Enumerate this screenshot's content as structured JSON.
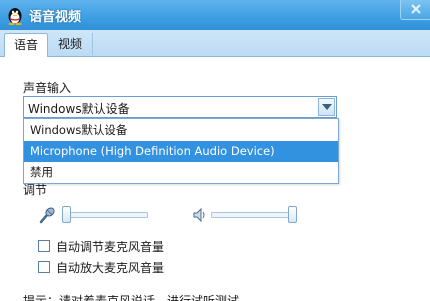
{
  "window": {
    "title": "语音视频"
  },
  "tabs": [
    {
      "label": "语音",
      "active": true
    },
    {
      "label": "视频",
      "active": false
    }
  ],
  "voice": {
    "input_label": "声音输入",
    "input_device": {
      "selected": "Windows默认设备"
    },
    "dropdown_options": [
      "Windows默认设备",
      "Microphone (High Definition Audio Device)",
      "禁用"
    ],
    "highlighted_option": "Microphone (High Definition Audio Device)",
    "adjust_label": "调节",
    "auto_adjust_mic": {
      "label": "自动调节麦克风音量",
      "checked": false
    },
    "auto_amplify_mic": {
      "label": "自动放大麦克风音量",
      "checked": false
    },
    "mic_volume_level": 0.0,
    "speaker_volume_level": 1.0,
    "tip_text": "提示：请对着麦克风说话，进行试听测试"
  },
  "colors": {
    "titlebar": "#3d9ee3",
    "tab_bar": "#c5e0f6",
    "selection": "#3292e0",
    "panel": "#ffffff"
  },
  "icons": {
    "app": "qq-penguin-icon",
    "close": "close-icon",
    "dropdown": "chevron-down-icon",
    "mic": "microphone-icon",
    "speaker": "speaker-icon"
  }
}
